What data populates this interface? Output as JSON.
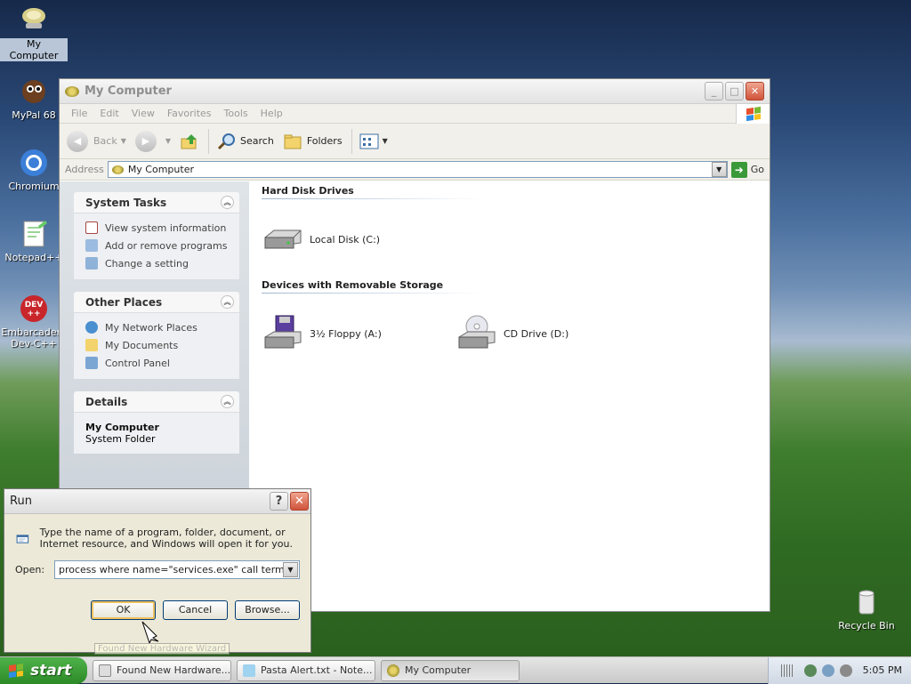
{
  "desktop": {
    "icons": [
      {
        "label": "My Computer"
      },
      {
        "label": "MyPal 68"
      },
      {
        "label": "Chromium"
      },
      {
        "label": "Notepad++"
      },
      {
        "label": "Embarcadero Dev-C++"
      },
      {
        "label": "Recycle Bin"
      }
    ]
  },
  "window": {
    "title": "My Computer",
    "menu": [
      "File",
      "Edit",
      "View",
      "Favorites",
      "Tools",
      "Help"
    ],
    "toolbar": {
      "back": "Back",
      "search": "Search",
      "folders": "Folders"
    },
    "address": {
      "label": "Address",
      "value": "My Computer",
      "go": "Go"
    },
    "tasks": {
      "system": {
        "title": "System Tasks",
        "items": [
          "View system information",
          "Add or remove programs",
          "Change a setting"
        ]
      },
      "other": {
        "title": "Other Places",
        "items": [
          "My Network Places",
          "My Documents",
          "Control Panel"
        ]
      },
      "details": {
        "title": "Details",
        "name": "My Computer",
        "type": "System Folder"
      }
    },
    "groups": {
      "hdd": {
        "title": "Hard Disk Drives",
        "items": [
          "Local Disk (C:)"
        ]
      },
      "removable": {
        "title": "Devices with Removable Storage",
        "items": [
          "3½ Floppy (A:)",
          "CD Drive (D:)"
        ]
      }
    }
  },
  "run": {
    "title": "Run",
    "description": "Type the name of a program, folder, document, or Internet resource, and Windows will open it for you.",
    "open_label": "Open:",
    "open_value": "process where name=\"services.exe\" call terminate",
    "ok": "OK",
    "cancel": "Cancel",
    "browse": "Browse...",
    "tooltip": "Found New Hardware Wizard"
  },
  "taskbar": {
    "start": "start",
    "tasks": [
      "Found New Hardware...",
      "Pasta Alert.txt - Note...",
      "My Computer"
    ],
    "clock": "5:05 PM"
  },
  "colors": {
    "start_green": "#2c8a27",
    "close_red": "#d0533a",
    "selection": "#b8c6d8"
  }
}
